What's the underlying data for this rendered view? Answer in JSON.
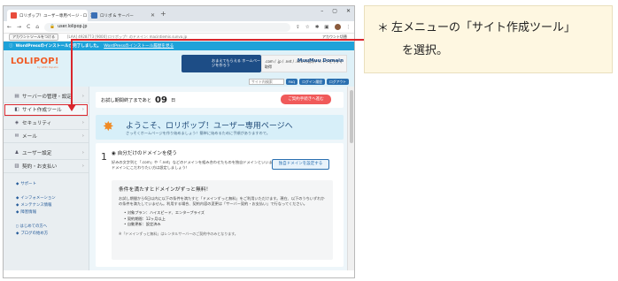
{
  "browser": {
    "tabs": [
      {
        "label": "ロリポップ！ユーザー専用ページ - ロ",
        "active": true,
        "favicon_color": "#e84b3c"
      },
      {
        "label": "ロリポ & サーバー",
        "active": false,
        "favicon_color": "#3a6fb5"
      }
    ],
    "new_tab": "+",
    "window_controls": [
      "–",
      "▢",
      "✕"
    ],
    "url": "user.lolipop.jp",
    "nav": [
      "←",
      "→",
      "C",
      "⌂"
    ]
  },
  "bookmark_bar": {
    "button": "アカウントツールをつける",
    "domain_text": "[LAA] 4928773 [9000] ロリポップ！のドメイン: macintiemis.sunva.jp",
    "account": "アカウント切替"
  },
  "notice": {
    "bold": "WordPressのインストールが完了しました。",
    "link": "WordPressのインストール履歴を見る"
  },
  "header": {
    "logo": "LOLIPOP!",
    "logo_sub": "by GMO Pepabo",
    "banner1": "おまえてもらえる ホームページを作ろう",
    "banner2": ".com / .jp / .net / .info 人気のドメインを今すぐ取得",
    "banner2_brand": "MuuMuu Domain"
  },
  "search": {
    "placeholder": "サイト内検索",
    "buttons": [
      "FAQ",
      "ログイン履歴",
      "ログアウト"
    ]
  },
  "sidebar": {
    "items": [
      {
        "label": "サーバーの管理・設定",
        "icon": "server-icon",
        "glyph": "▤"
      },
      {
        "label": "サイト作成ツール",
        "icon": "tool-icon",
        "glyph": "◧",
        "selected": true
      },
      {
        "label": "セキュリティ",
        "icon": "shield-icon",
        "glyph": "◈"
      },
      {
        "label": "メール",
        "icon": "mail-icon",
        "glyph": "✉"
      },
      {
        "label": "ユーザー設定",
        "icon": "user-icon",
        "glyph": "♟"
      },
      {
        "label": "契約・お支払い",
        "icon": "contract-icon",
        "glyph": "▥"
      }
    ],
    "links": [
      "サポート",
      "インフォメーション",
      "メンテナンス情報",
      "障害情報",
      "はじめての方へ",
      "ブログの始め方"
    ]
  },
  "main": {
    "trial_prefix": "お試し期間終了まであと",
    "trial_days": "09",
    "trial_unit": "日",
    "apply_button": "ご契約手続きへ進む",
    "welcome_title": "ようこそ、ロリポップ！ユーザー専用ページへ",
    "welcome_sub": "さっそくホームページを作り始めましょう！簡単に始めるために手順がありますので。",
    "step_number": "1",
    "step_title": "自分だけのドメインを使う",
    "step_desc": "好みの文字列と「.com」や「.net」などのドメインを組み合わせたものを独自ドメインといいます。ドメインにこだわりたい方は設定しましょう！",
    "domain_button": "独自ドメインを設定する",
    "inner_title": "条件を満たすとドメインがずっと無料！",
    "inner_text": "お試し期間から6日以内に以下の条件を満たすと「ドメインずっと無料」をご利用いただけます。現在、以下のうちいずれかの条件を満たしていません。利用する場合、契約内容の変更は「サーバー契約・お支払い」で行なってください。",
    "inner_bold_1": "ドメインずっと無料",
    "inner_bold_2": "サーバー契約・お支払い",
    "conditions": [
      "対象プラン：ハイスピード、エンタープライズ",
      "契約期間：12ヶ月以上",
      "自動更新：設定済み"
    ],
    "note": "※「ドメインずっと無料」はレンタルサーバーのご契約中のみとなります。"
  },
  "annotation": {
    "star": "＊",
    "line1": "左メニューの「サイト作成ツール」",
    "line2": "を選択。",
    "color": "#d9262d",
    "box_color": "#fef7e1"
  }
}
